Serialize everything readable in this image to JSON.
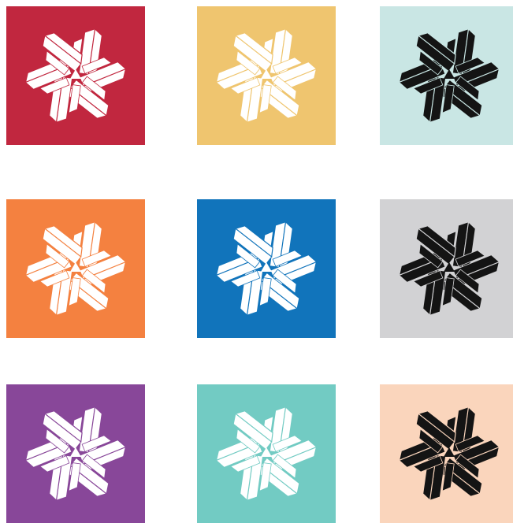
{
  "logo_icon": "pinwheel-logo-icon",
  "swatches": [
    {
      "id": "crimson",
      "background": "#C1273F",
      "logo_color": "#FFFFFF"
    },
    {
      "id": "mustard",
      "background": "#EFC56F",
      "logo_color": "#FFFFFF"
    },
    {
      "id": "mint",
      "background": "#C9E6E4",
      "logo_color": "#141414"
    },
    {
      "id": "orange",
      "background": "#F48140",
      "logo_color": "#FFFFFF"
    },
    {
      "id": "blue",
      "background": "#1174BB",
      "logo_color": "#FFFFFF"
    },
    {
      "id": "grey",
      "background": "#D2D2D4",
      "logo_color": "#141414"
    },
    {
      "id": "purple",
      "background": "#884799",
      "logo_color": "#FFFFFF"
    },
    {
      "id": "teal",
      "background": "#72CBC3",
      "logo_color": "#FFFFFF"
    },
    {
      "id": "peach",
      "background": "#FAD5BC",
      "logo_color": "#141414"
    }
  ]
}
